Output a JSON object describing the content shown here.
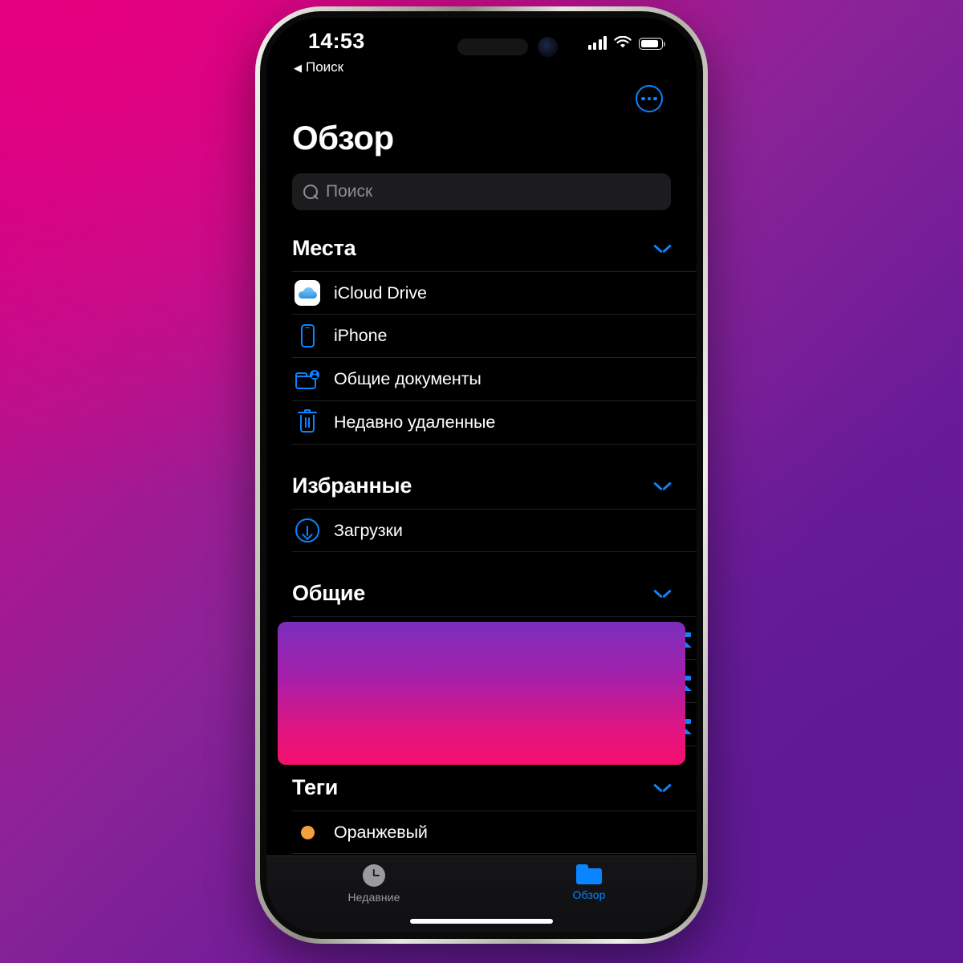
{
  "status_bar": {
    "time": "14:53",
    "back_label": "Поиск",
    "back_arrow": "◀",
    "signal_icon": "cellular-signal-icon",
    "wifi_icon": "wifi-icon",
    "battery_icon": "battery-icon"
  },
  "nav": {
    "more_button": "more-ellipsis-button"
  },
  "header": {
    "title": "Обзор"
  },
  "search": {
    "placeholder": "Поиск",
    "value": "",
    "icon": "search-icon"
  },
  "sections": [
    {
      "id": "places",
      "title": "Места",
      "collapse_icon": "chevron-down-icon",
      "items": [
        {
          "label": "iCloud Drive",
          "icon": "icloud-drive-icon",
          "trailing": ""
        },
        {
          "label": "iPhone",
          "icon": "iphone-icon",
          "trailing": ""
        },
        {
          "label": "Общие документы",
          "icon": "shared-folder-icon",
          "trailing": ""
        },
        {
          "label": "Недавно удаленные",
          "icon": "trash-icon",
          "trailing": ""
        }
      ]
    },
    {
      "id": "favorites",
      "title": "Избранные",
      "collapse_icon": "chevron-down-icon",
      "items": [
        {
          "label": "Загрузки",
          "icon": "download-circle-icon",
          "trailing": ""
        }
      ]
    },
    {
      "id": "shared",
      "title": "Общие",
      "collapse_icon": "chevron-down-icon",
      "highlighted": true,
      "items": [
        {
          "label": "",
          "redacted": true,
          "redacted_width": 110,
          "icon": "globe-icon",
          "trailing": "eject-icon"
        },
        {
          "label": "",
          "redacted": true,
          "redacted_width": 205,
          "icon": "globe-icon",
          "trailing": "eject-icon"
        },
        {
          "label": "",
          "redacted": true,
          "redacted_width": 140,
          "icon": "globe-icon",
          "trailing": "eject-icon"
        }
      ]
    },
    {
      "id": "tags",
      "title": "Теги",
      "collapse_icon": "chevron-down-icon",
      "items": [
        {
          "label": "Оранжевый",
          "icon": "tag-dot-orange",
          "tag_color": "#f0a03c",
          "trailing": ""
        }
      ]
    }
  ],
  "tab_bar": {
    "tabs": [
      {
        "label": "Недавние",
        "icon": "clock-icon",
        "active": false
      },
      {
        "label": "Обзор",
        "icon": "folder-icon",
        "active": true
      }
    ]
  },
  "colors": {
    "accent_blue": "#0a84ff",
    "highlight_top": "#7b2fbe",
    "highlight_bottom": "#f50f6e",
    "tag_orange": "#f0a03c",
    "background_magenta": "#d6008a",
    "background_purple": "#5b1792"
  }
}
